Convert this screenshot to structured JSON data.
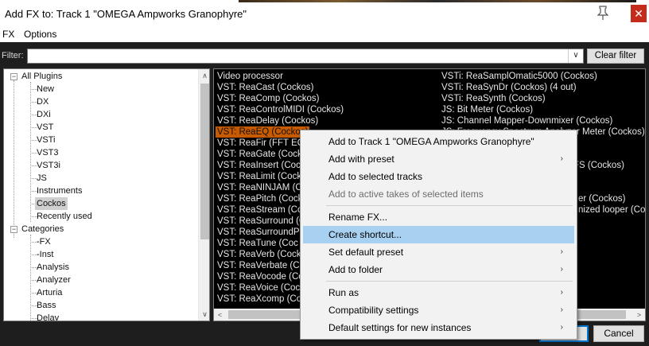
{
  "window": {
    "title": "Add FX to: Track 1 \"OMEGA Ampworks Granophyre\"",
    "close_glyph": "✕",
    "pin_glyph": "📌"
  },
  "menu": {
    "items": [
      "FX",
      "Options"
    ]
  },
  "filter": {
    "label": "Filter:",
    "value": "",
    "clear_label": "Clear filter",
    "dropdown_glyph": "∨"
  },
  "tree": {
    "groups": [
      {
        "label": "All Plugins",
        "toggle": "−",
        "children": [
          "New",
          "DX",
          "DXi",
          "VST",
          "VSTi",
          "VST3",
          "VST3i",
          "JS",
          "Instruments",
          "Cockos",
          "Recently used"
        ],
        "selected": "Cockos"
      },
      {
        "label": "Categories",
        "toggle": "−",
        "children": [
          "-FX",
          "-Inst",
          "Analysis",
          "Analyzer",
          "Arturia",
          "Bass",
          "Delay"
        ]
      }
    ]
  },
  "list": {
    "col1": [
      "Video processor",
      "VST: ReaCast (Cockos)",
      "VST: ReaComp (Cockos)",
      "VST: ReaControlMIDI (Cockos)",
      "VST: ReaDelay (Cockos)",
      "VST: ReaEQ (Cockos)",
      "VST: ReaFir (FFT EQ+",
      "VST: ReaGate (Cocko",
      "VST: ReaInsert (Cock",
      "VST: ReaLimit (Cock",
      "VST: ReaNINJAM (Co",
      "VST: ReaPitch (Cock",
      "VST: ReaStream (Co",
      "VST: ReaSurround (Co",
      "VST: ReaSurroundPa",
      "VST: ReaTune (Coc",
      "VST: ReaVerb (Cock",
      "VST: ReaVerbate (Co",
      "VST: ReaVocode (Co",
      "VST: ReaVoice (Cock",
      "VST: ReaXcomp (Coc"
    ],
    "col2": [
      "VSTi: ReaSamplOmatic5000 (Cockos)",
      "VSTi: ReaSynDr (Cockos) (4 out)",
      "VSTi: ReaSynth (Cockos)",
      "JS: Bit Meter (Cockos)",
      "JS: Channel Mapper-Downmixer (Cockos)",
      "JS: Frequency Spectrum Analyzer Meter (Cockos)"
    ],
    "col2_partial": [
      "FS (Cockos)",
      "er (Cockos)",
      "nized looper (Cock"
    ],
    "selected": "VST: ReaEQ (Cockos)"
  },
  "buttons": {
    "ok": "",
    "cancel": "Cancel"
  },
  "context_menu": {
    "items": [
      {
        "label": "Add to Track 1 \"OMEGA Ampworks Granophyre\"",
        "submenu": false,
        "disabled": false
      },
      {
        "label": "Add with preset",
        "submenu": true,
        "disabled": false
      },
      {
        "label": "Add to selected tracks",
        "submenu": false,
        "disabled": false
      },
      {
        "label": "Add to active takes of selected items",
        "submenu": false,
        "disabled": true
      },
      {
        "label": "Rename FX...",
        "submenu": false,
        "disabled": false
      },
      {
        "label": "Create shortcut...",
        "submenu": false,
        "disabled": false,
        "highlighted": true
      },
      {
        "label": "Set default preset",
        "submenu": true,
        "disabled": false
      },
      {
        "label": "Add to folder",
        "submenu": true,
        "disabled": false
      },
      {
        "label": "Run as",
        "submenu": true,
        "disabled": false
      },
      {
        "label": "Compatibility settings",
        "submenu": true,
        "disabled": false
      },
      {
        "label": "Default settings for new instances",
        "submenu": true,
        "disabled": false
      }
    ],
    "submenu_glyph": "›"
  },
  "colors": {
    "selection_orange": "#c85a00",
    "highlight_blue": "#a8d0f0",
    "close_red": "#c42b1c"
  }
}
